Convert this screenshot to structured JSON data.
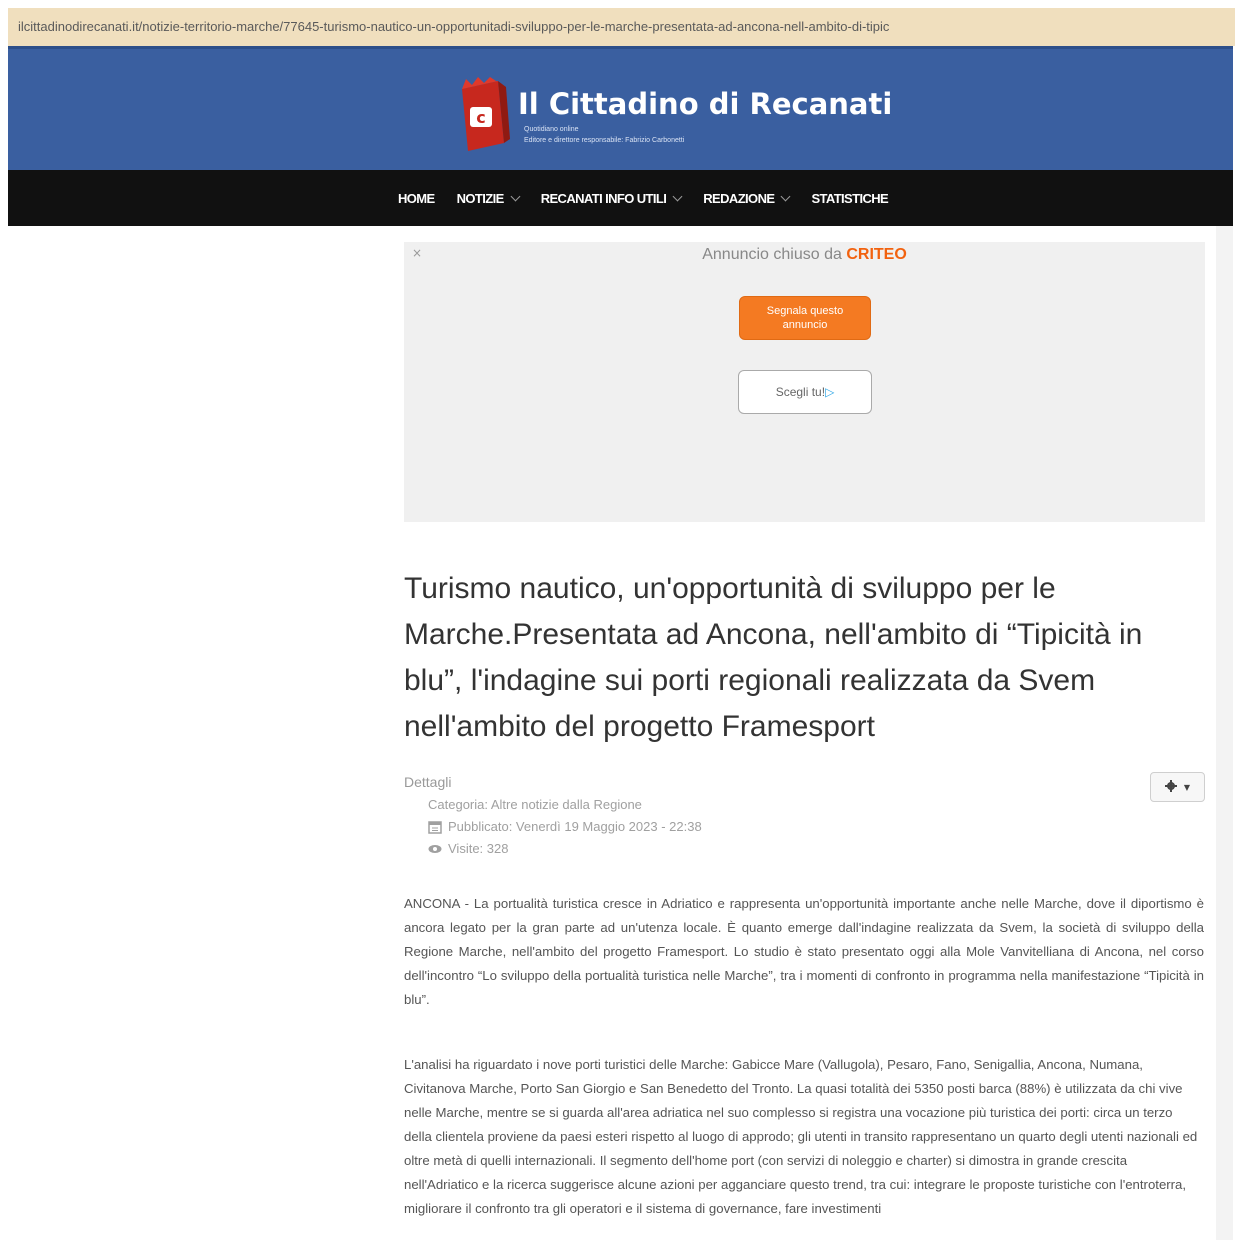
{
  "browser": {
    "url": "ilcittadinodirecanati.it/notizie-territorio-marche/77645-turismo-nautico-un-opportunitadi-sviluppo-per-le-marche-presentata-ad-ancona-nell-ambito-di-tipic"
  },
  "header": {
    "site_title": "Il Cittadino di Recanati",
    "sub_line1": "Quotidiano online",
    "sub_line2": "Editore e direttore responsabile: Fabrizio Carbonetti",
    "brand_color": "#3a5fa0"
  },
  "nav": {
    "items": [
      {
        "label": "HOME",
        "dropdown": false
      },
      {
        "label": "NOTIZIE",
        "dropdown": true
      },
      {
        "label": "RECANATI INFO UTILI",
        "dropdown": true
      },
      {
        "label": "REDAZIONE",
        "dropdown": true
      },
      {
        "label": "STATISTICHE",
        "dropdown": false
      }
    ]
  },
  "ad": {
    "close_mark": "×",
    "closed_text": "Annuncio chiuso da",
    "criteo": "CRITEO",
    "report_line1": "Segnala questo",
    "report_line2": "annuncio",
    "why_label": "Scegli tu!",
    "accent": "#f47a22"
  },
  "article": {
    "title": "Turismo nautico, un'opportunità di sviluppo per le Marche.Presentata ad Ancona, nell'ambito di “Tipicità in blu”, l'indagine sui porti regionali realizzata da Svem nell'ambito del progetto Framesport",
    "details_label": "Dettagli",
    "category": "Categoria: Altre notizie dalla Regione",
    "published": "Pubblicato: Venerdì 19 Maggio 2023 - 22:38",
    "hits": "Visite: 328",
    "paragraph1": "ANCONA - La portualità turistica cresce in Adriatico e rappresenta un'opportunità importante anche nelle Marche, dove il diportismo è ancora legato per la gran parte ad un'utenza locale. È quanto emerge dall'indagine realizzata da Svem, la società di sviluppo della Regione Marche, nell'ambito del progetto Framesport. Lo studio è stato presentato oggi alla Mole Vanvitelliana di Ancona, nel corso dell'incontro “Lo sviluppo della portualità turistica nelle Marche”, tra i momenti di confronto in programma nella manifestazione “Tipicità in blu”.",
    "paragraph2": "L'analisi ha riguardato i nove porti turistici delle Marche: Gabicce Mare (Vallugola), Pesaro, Fano, Senigallia, Ancona, Numana, Civitanova Marche, Porto San Giorgio e San Benedetto del Tronto. La quasi totalità dei 5350 posti barca (88%) è utilizzata da chi vive nelle Marche, mentre se si guarda all'area adriatica nel suo complesso si registra una vocazione più turistica dei porti: circa un terzo della clientela proviene da paesi esteri rispetto al luogo di approdo; gli utenti in transito rappresentano un quarto degli utenti nazionali ed oltre metà di quelli internazionali. Il segmento dell'home port (con servizi di noleggio e charter) si dimostra in grande crescita nell'Adriatico e la ricerca suggerisce alcune azioni per agganciare questo trend, tra cui: integrare le proposte turistiche con l'entroterra, migliorare il confronto tra gli operatori e il sistema di governance, fare investimenti"
  }
}
